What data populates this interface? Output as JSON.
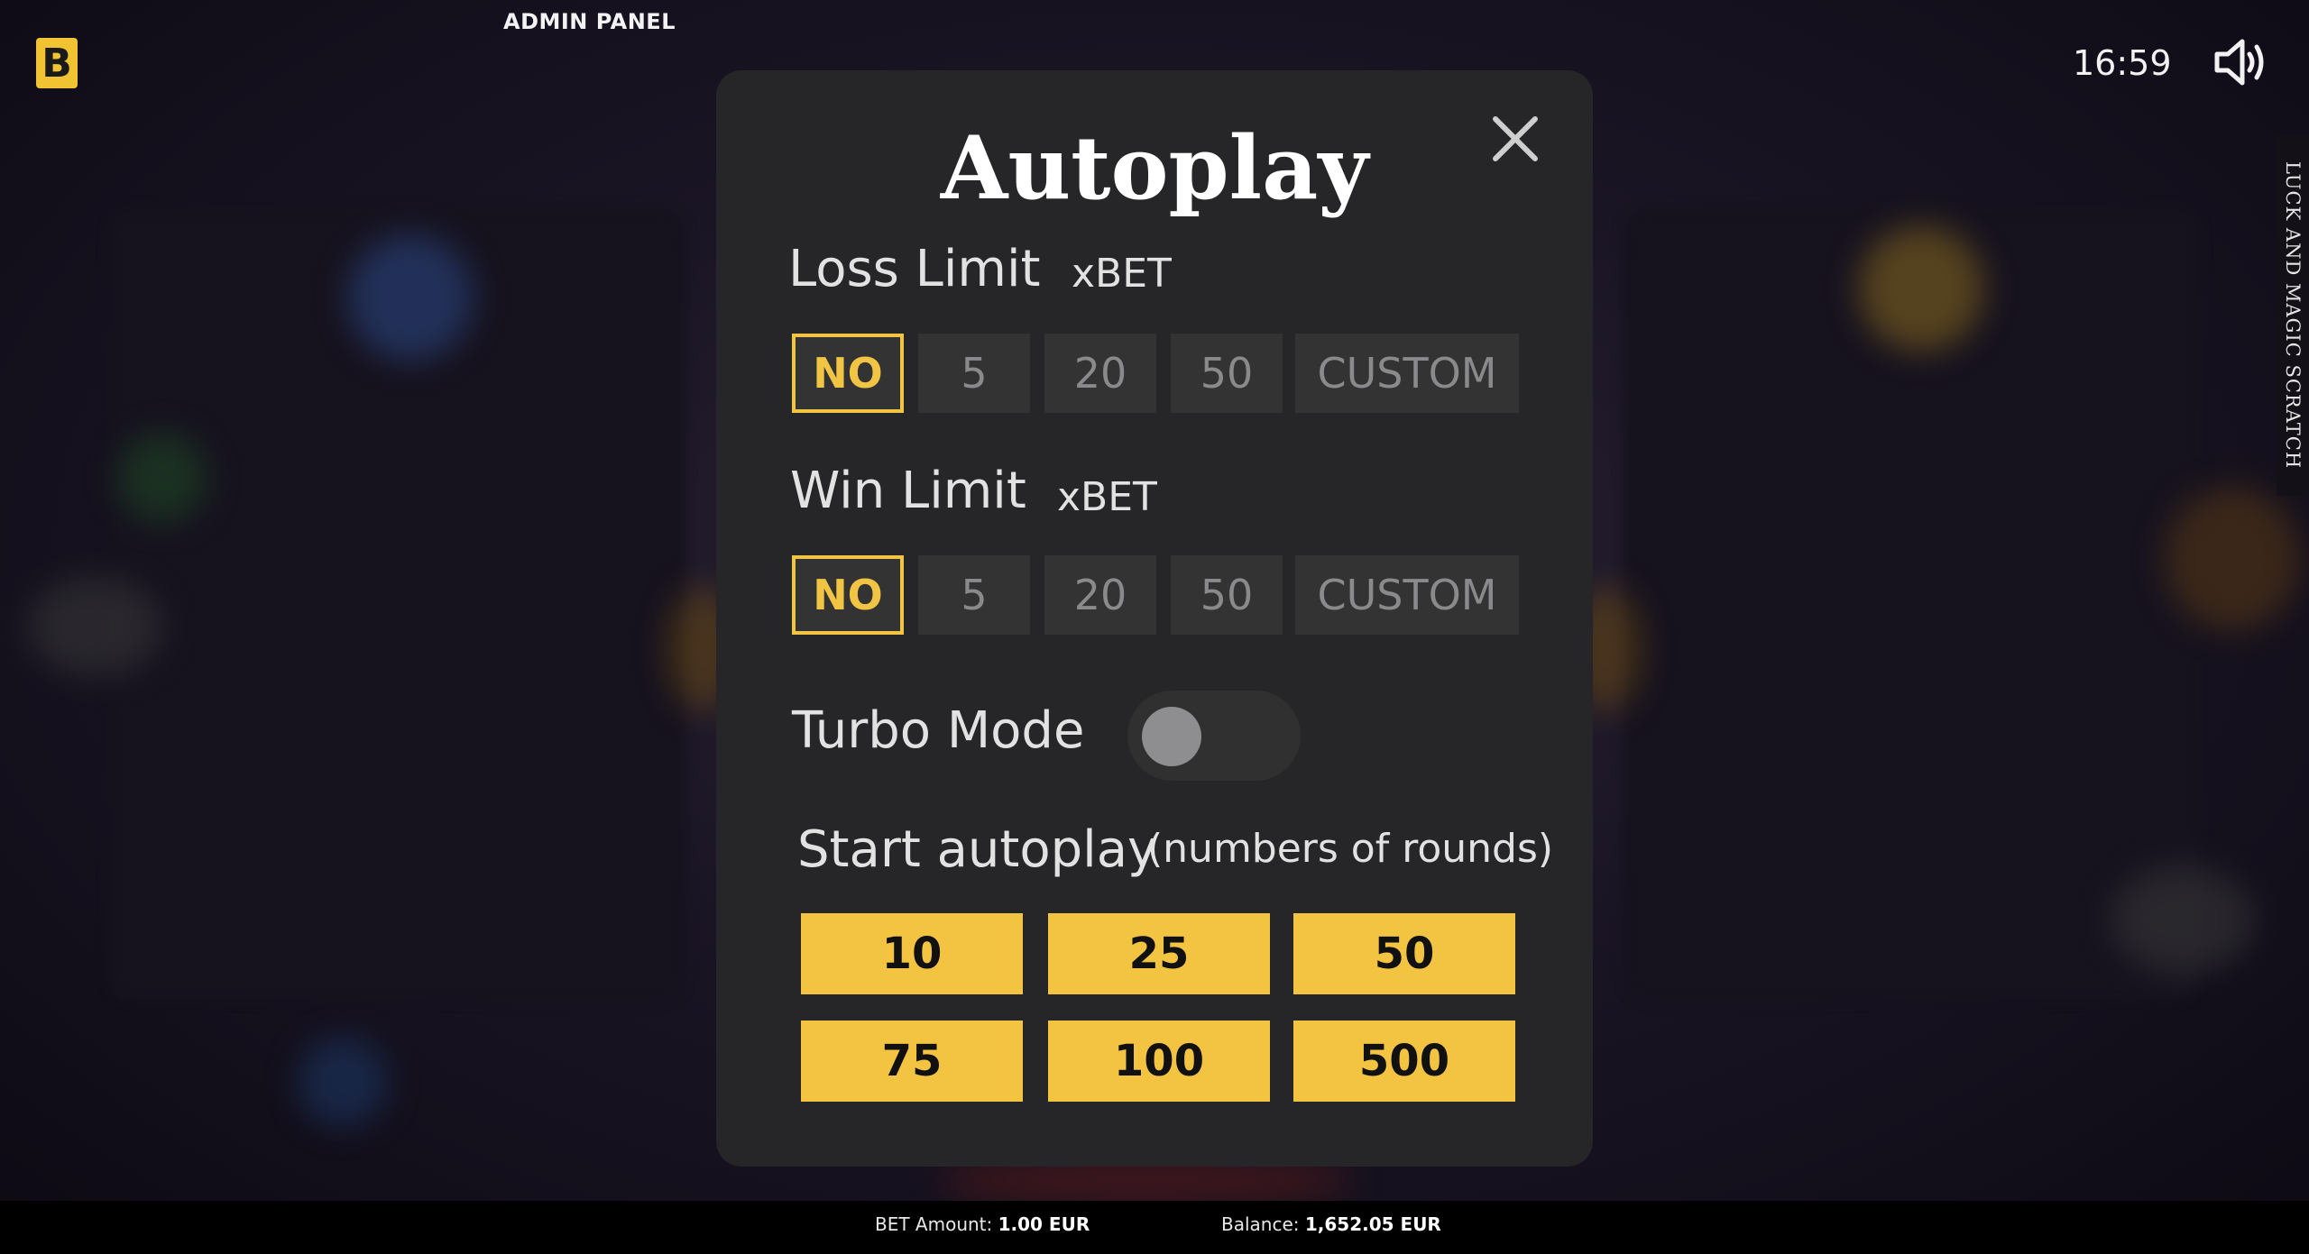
{
  "top_bar": {
    "logo_letter": "B",
    "admin_panel": "ADMIN PANEL",
    "time": "16:59",
    "sound_icon": "speaker-icon"
  },
  "side_label": "LUCK AND MAGIC SCRATCH",
  "modal": {
    "title": "Autoplay",
    "close_icon": "close-icon",
    "loss_limit": {
      "label": "Loss Limit",
      "unit": "xBET",
      "options": [
        "NO",
        "5",
        "20",
        "50",
        "CUSTOM"
      ],
      "selected": "NO"
    },
    "win_limit": {
      "label": "Win Limit",
      "unit": "xBET",
      "options": [
        "NO",
        "5",
        "20",
        "50",
        "CUSTOM"
      ],
      "selected": "NO"
    },
    "turbo_mode": {
      "label": "Turbo Mode",
      "enabled": false
    },
    "start_autoplay": {
      "label": "Start autoplay",
      "sublabel": "(numbers of rounds)",
      "rounds": [
        "10",
        "25",
        "50",
        "75",
        "100",
        "500"
      ]
    }
  },
  "bottom_bar": {
    "bet_label": "BET Amount:",
    "bet_value": "1.00 EUR",
    "balance_label": "Balance:",
    "balance_value": "1,652.05 EUR"
  },
  "colors": {
    "accent": "#f2c444",
    "modal_bg": "#262527",
    "option_bg": "#333334"
  }
}
